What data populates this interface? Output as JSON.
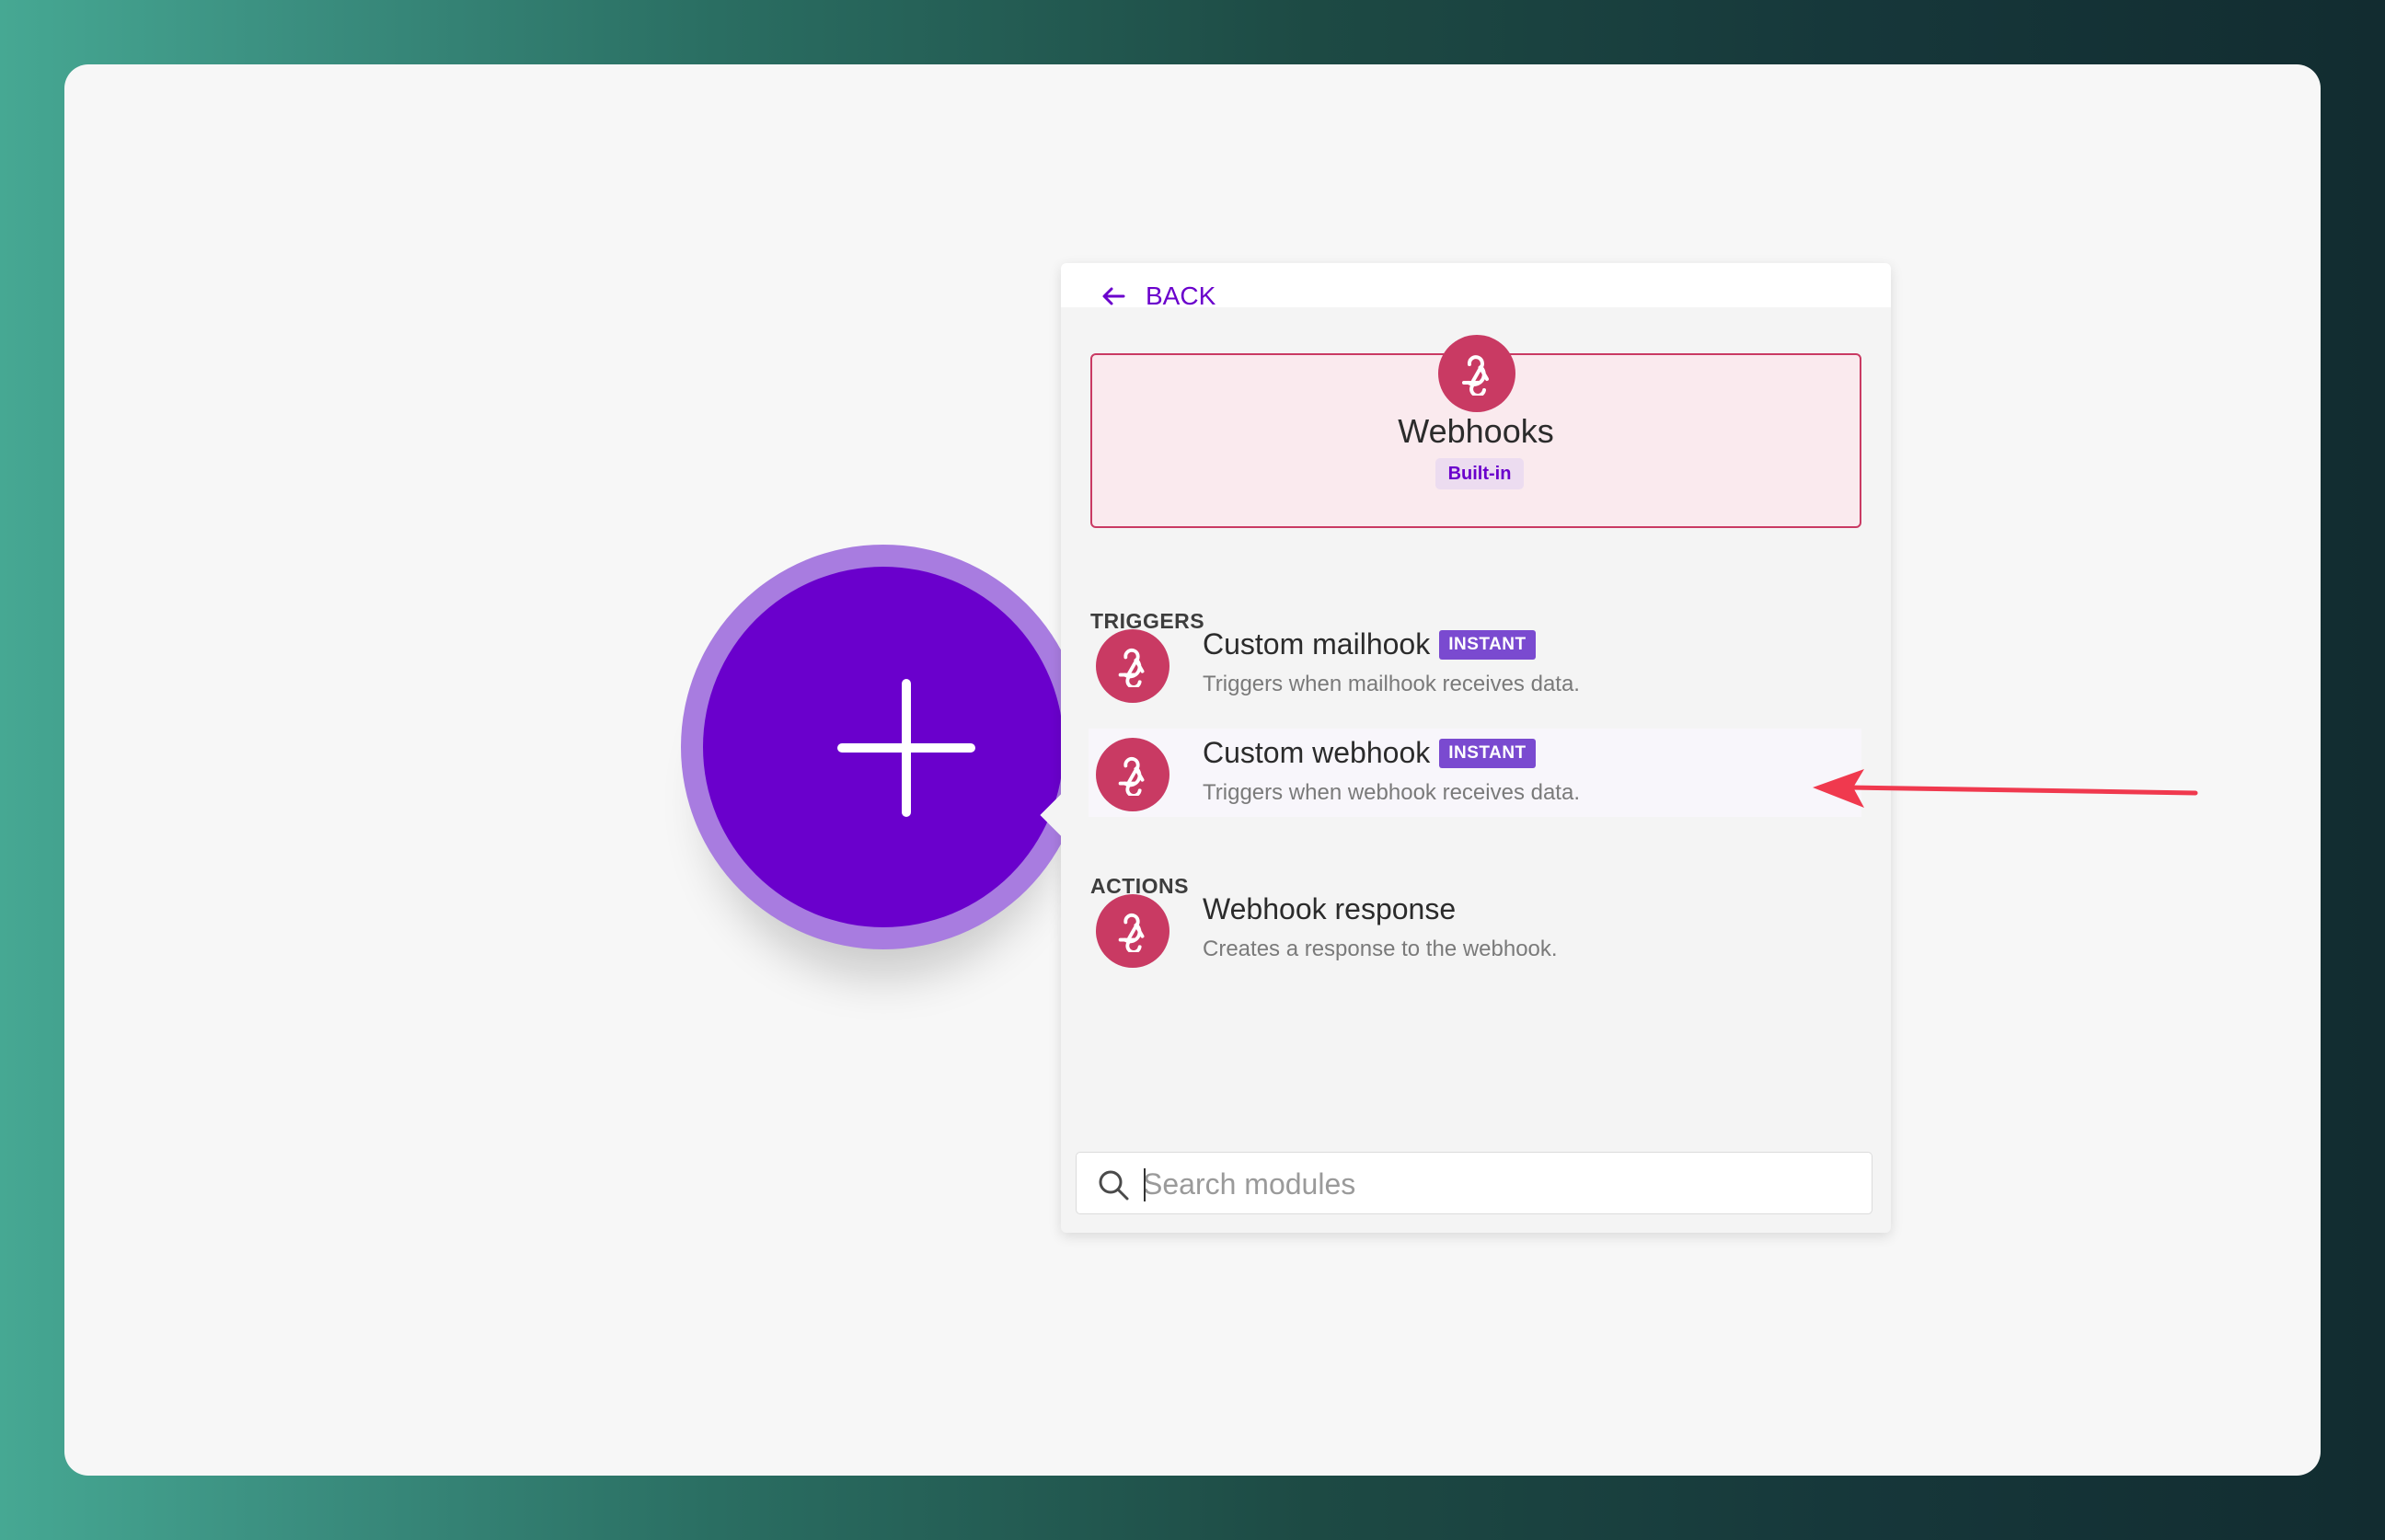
{
  "panel": {
    "back_label": "BACK",
    "app": {
      "name": "Webhooks",
      "badge": "Built-in",
      "icon": "webhook-icon",
      "color": "#c93a63"
    },
    "triggers_title": "TRIGGERS",
    "triggers": [
      {
        "title": "Custom mailhook",
        "badge": "INSTANT",
        "description": "Triggers when mailhook receives data."
      },
      {
        "title": "Custom webhook",
        "badge": "INSTANT",
        "description": "Triggers when webhook receives data."
      }
    ],
    "actions_title": "ACTIONS",
    "actions": [
      {
        "title": "Webhook response",
        "description": "Creates a response to the webhook."
      }
    ],
    "search": {
      "placeholder": "Search modules",
      "value": ""
    }
  },
  "colors": {
    "accent": "#6a00cc",
    "instant_badge": "#7a4ad0",
    "annotation_arrow": "#f0394e"
  }
}
